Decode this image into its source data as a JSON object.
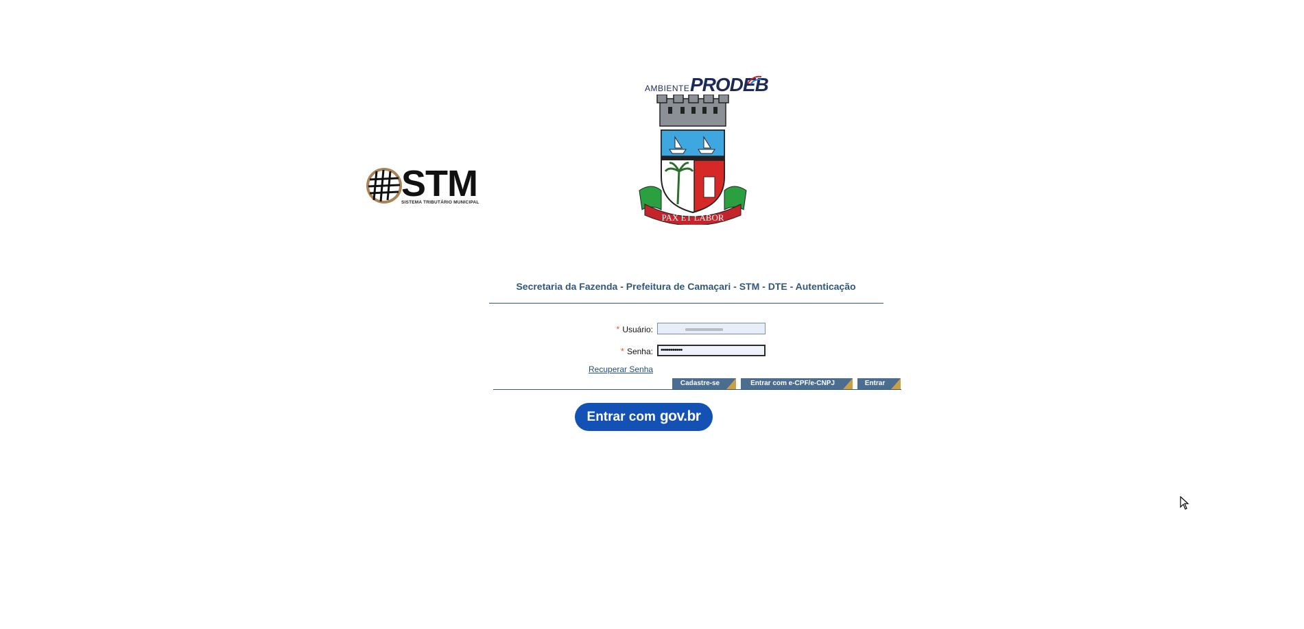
{
  "logos": {
    "stm_brand": "STM",
    "stm_subtitle": "SISTEMA TRIBUTÁRIO MUNICIPAL",
    "prodeb_prefix": "AMBIENTE",
    "prodeb_name": "PRODEB",
    "coat_motto": "PAX ET LABOR"
  },
  "page": {
    "title": "Secretaria da Fazenda - Prefeitura de Camaçari - STM - DTE - Autenticação"
  },
  "form": {
    "required_mark": "*",
    "user_label": "Usuário:",
    "user_value": "",
    "password_label": "Senha:",
    "password_value": "•••••••••••",
    "recover_link": "Recuperar Senha"
  },
  "buttons": {
    "cadastre": "Cadastre-se",
    "ecpf": "Entrar com e-CPF/e-CNPJ",
    "entrar": "Entrar"
  },
  "govbr": {
    "prefix": "Entrar com",
    "brand": "gov.br"
  },
  "colors": {
    "accent": "#30577c",
    "button": "#4b6d8f",
    "button_corner": "#c9a145",
    "govbr": "#1351b4",
    "required": "#e3601d"
  }
}
